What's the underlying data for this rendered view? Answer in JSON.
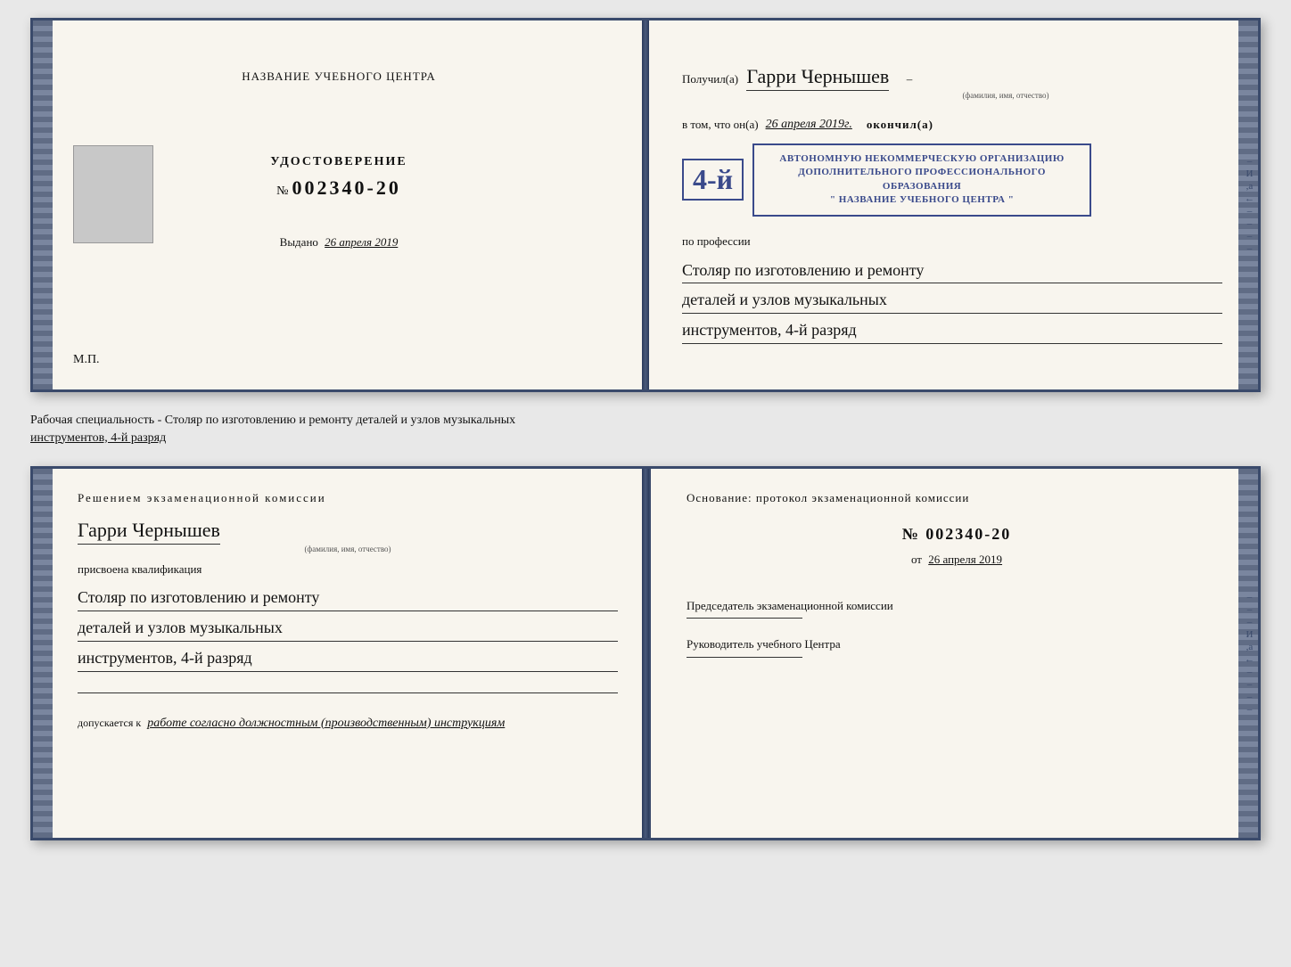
{
  "top_book": {
    "left_page": {
      "title": "НАЗВАНИЕ УЧЕБНОГО ЦЕНТРА",
      "document_type": "УДОСТОВЕРЕНИЕ",
      "number_label": "№",
      "number": "002340-20",
      "vydano_label": "Выдано",
      "vydano_date": "26 апреля 2019",
      "mp_label": "М.П."
    },
    "right_page": {
      "received_label": "Получил(а)",
      "recipient_name": "Гарри Чернышев",
      "name_subline": "(фамилия, имя, отчество)",
      "vtom_prefix": "в том, что он(а)",
      "vtom_date": "26 апреля 2019г.",
      "okончил_label": "окончил(а)",
      "stamp_line1": "АВТОНОМНУЮ НЕКОММЕРЧЕСКУЮ ОРГАНИЗАЦИЮ",
      "stamp_line2": "ДОПОЛНИТЕЛЬНОГО ПРОФЕССИОНАЛЬНОГО ОБРАЗОВАНИЯ",
      "stamp_line3": "\" НАЗВАНИЕ УЧЕБНОГО ЦЕНТРА \"",
      "stamp_number": "4-й",
      "po_professii_label": "по профессии",
      "profession_line1": "Столяр по изготовлению и ремонту",
      "profession_line2": "деталей и узлов музыкальных",
      "profession_line3": "инструментов, 4-й разряд"
    }
  },
  "between_text": {
    "line1": "Рабочая специальность - Столяр по изготовлению и ремонту деталей и узлов музыкальных",
    "line2": "инструментов, 4-й разряд"
  },
  "bottom_book": {
    "left_page": {
      "title": "Решением экзаменационной комиссии",
      "recipient_name": "Гарри Чернышев",
      "name_subline": "(фамилия, имя, отчество)",
      "prisvoena_label": "присвоена квалификация",
      "qualification_line1": "Столяр по изготовлению и ремонту",
      "qualification_line2": "деталей и узлов музыкальных",
      "qualification_line3": "инструментов, 4-й разряд",
      "dopuskaetsya_prefix": "допускается к",
      "dopuskaetsya_text": "работе согласно должностным (производственным) инструкциям"
    },
    "right_page": {
      "osnovaniye_label": "Основание: протокол экзаменационной комиссии",
      "number_label": "№",
      "number": "002340-20",
      "ot_label": "от",
      "ot_date": "26 апреля 2019",
      "predsedatel_label": "Председатель экзаменационной комиссии",
      "rukovoditel_label": "Руководитель учебного Центра"
    },
    "side_letters": [
      "И",
      "а",
      "←",
      "–",
      "–",
      "–",
      "–"
    ]
  }
}
